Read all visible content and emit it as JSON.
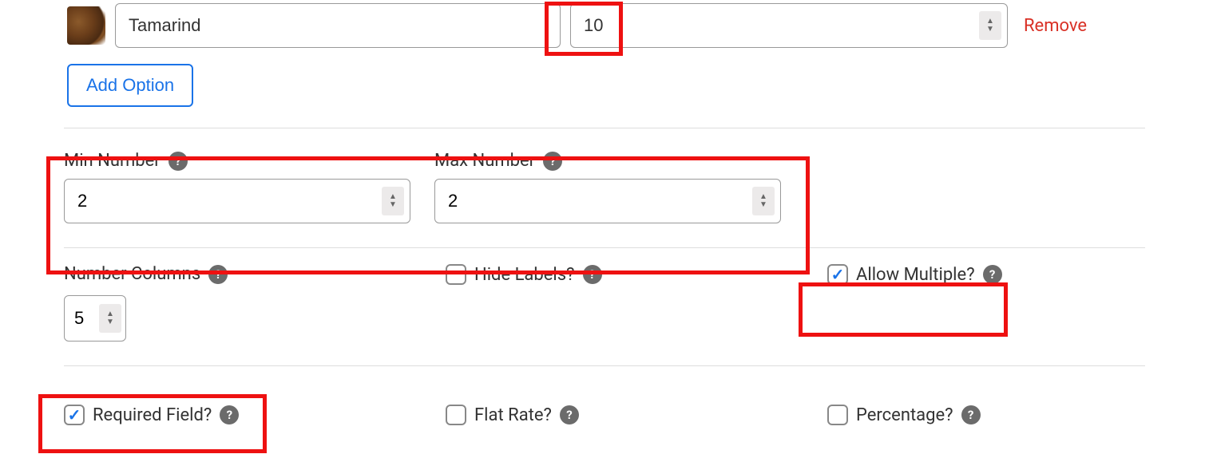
{
  "option_row": {
    "name": "Tamarind",
    "value": "10",
    "remove_label": "Remove"
  },
  "add_option_label": "Add Option",
  "min_number": {
    "label": "Min Number",
    "value": "2"
  },
  "max_number": {
    "label": "Max Number",
    "value": "2"
  },
  "number_columns": {
    "label": "Number Columns",
    "value": "5"
  },
  "hide_labels": {
    "label": "Hide Labels?",
    "checked": false
  },
  "allow_multiple": {
    "label": "Allow Multiple?",
    "checked": true
  },
  "required_field": {
    "label": "Required Field?",
    "checked": true
  },
  "flat_rate": {
    "label": "Flat Rate?",
    "checked": false
  },
  "percentage": {
    "label": "Percentage?",
    "checked": false
  }
}
